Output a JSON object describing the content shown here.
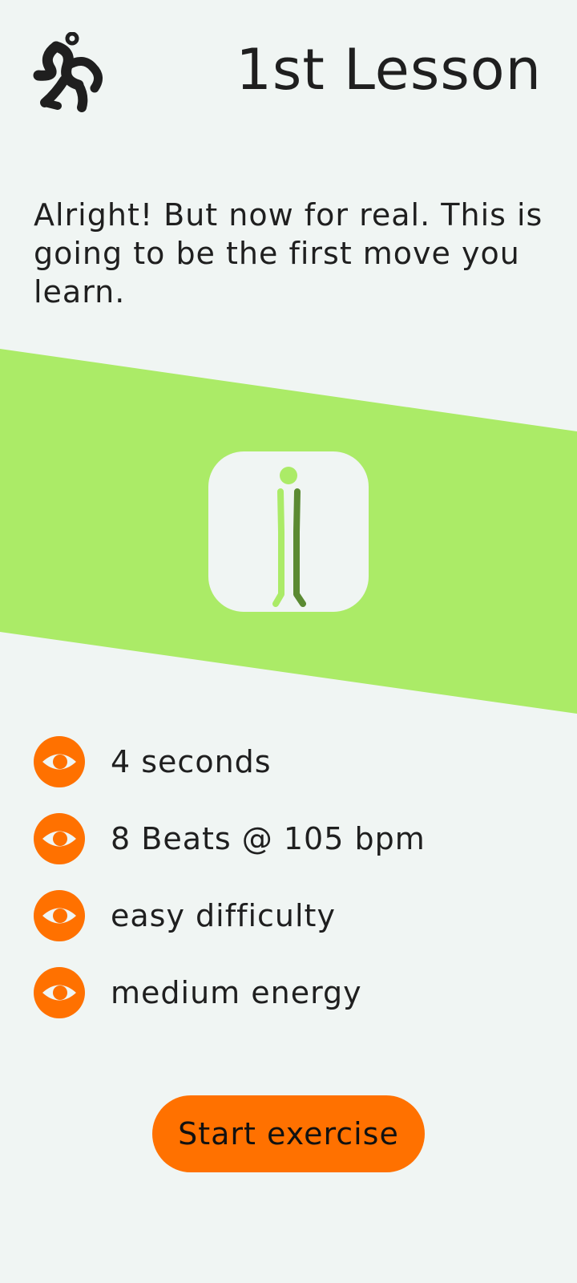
{
  "header": {
    "logo_icon": "dancer-logo-icon",
    "title": "1st Lesson"
  },
  "intro": {
    "text": "Alright! But now for real. This is going to be the first move you learn."
  },
  "illustration": {
    "icon": "standing-figure-icon",
    "band_color": "#abeb67",
    "figure_light_color": "#abeb67",
    "figure_dark_color": "#5b8a32"
  },
  "stats": [
    {
      "icon": "eye-icon",
      "label": "4 seconds"
    },
    {
      "icon": "eye-icon",
      "label": "8 Beats @ 105 bpm"
    },
    {
      "icon": "eye-icon",
      "label": "easy difficulty"
    },
    {
      "icon": "eye-icon",
      "label": "medium energy"
    }
  ],
  "cta": {
    "label": "Start exercise"
  },
  "colors": {
    "background": "#f0f5f3",
    "accent": "#ff7100",
    "text": "#1f1f1f"
  }
}
